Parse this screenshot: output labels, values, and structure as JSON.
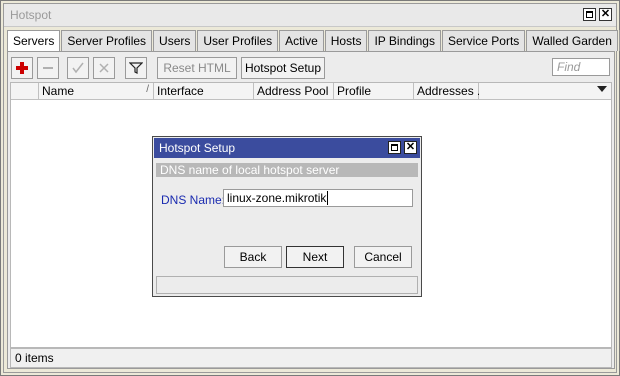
{
  "window": {
    "title": "Hotspot",
    "close_glyph": "✕"
  },
  "tabs": [
    {
      "label": "Servers"
    },
    {
      "label": "Server Profiles"
    },
    {
      "label": "Users"
    },
    {
      "label": "User Profiles"
    },
    {
      "label": "Active"
    },
    {
      "label": "Hosts"
    },
    {
      "label": "IP Bindings"
    },
    {
      "label": "Service Ports"
    },
    {
      "label": "Walled Garden"
    },
    {
      "label": "..."
    }
  ],
  "toolbar": {
    "add_icon": "plus-icon",
    "remove_icon": "minus-icon",
    "enable_icon": "check-icon",
    "disable_icon": "x-icon",
    "filter_icon": "filter-icon",
    "reset_html_label": "Reset HTML",
    "hotspot_setup_label": "Hotspot Setup",
    "find_placeholder": "Find"
  },
  "grid": {
    "columns": [
      "Name",
      "Interface",
      "Address Pool",
      "Profile",
      "Addresses ..."
    ],
    "sort_indicator": "/"
  },
  "status": {
    "text": "0 items"
  },
  "dialog": {
    "title": "Hotspot Setup",
    "close_glyph": "✕",
    "subtitle": "DNS name of local hotspot server",
    "dns_label": "DNS Name:",
    "dns_value": "linux-zone.mikrotik",
    "back_label": "Back",
    "next_label": "Next",
    "cancel_label": "Cancel"
  },
  "colors": {
    "dialog_title_bg": "#3b4c9e",
    "add_icon": "#cc0000",
    "label_blue": "#1a2bb0"
  }
}
